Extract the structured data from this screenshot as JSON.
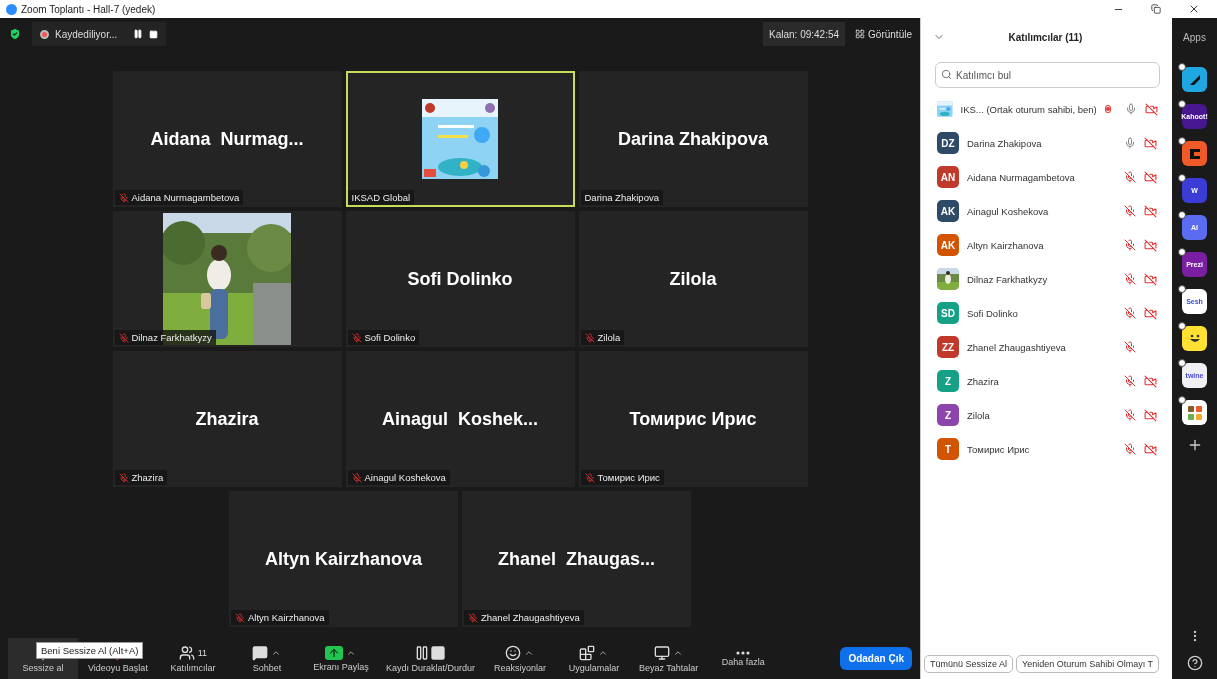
{
  "window": {
    "title": "Zoom Toplantı - Hall-7 (yedek)"
  },
  "top_bar": {
    "recording": "Kaydediliyor...",
    "remaining": "Kalan: 09:42:54",
    "view": "Görüntüle"
  },
  "tile_rows": [
    [
      {
        "kind": "name",
        "big_name": "Aidana  Nurmag...",
        "label": "Aidana Nurmagambetova",
        "muted": true,
        "selected": false
      },
      {
        "kind": "logo",
        "label": "IKSAD Global",
        "muted": false,
        "selected": true
      },
      {
        "kind": "name",
        "big_name": "Darina Zhakipova",
        "label": "Darina Zhakipova",
        "muted": false,
        "selected": false
      }
    ],
    [
      {
        "kind": "video",
        "label": "Dilnaz Farkhatkyzy",
        "muted": true,
        "selected": false
      },
      {
        "kind": "name",
        "big_name": "Sofi Dolinko",
        "label": "Sofi Dolinko",
        "muted": true,
        "selected": false
      },
      {
        "kind": "name",
        "big_name": "Zilola",
        "label": "Zilola",
        "muted": true,
        "selected": false
      }
    ],
    [
      {
        "kind": "name",
        "big_name": "Zhazira",
        "label": "Zhazira",
        "muted": true,
        "selected": false
      },
      {
        "kind": "name",
        "big_name": "Ainagul  Koshek...",
        "label": "Ainagul Koshekova",
        "muted": true,
        "selected": false
      },
      {
        "kind": "name",
        "big_name": "Томирис Ирис",
        "label": "Томирис Ирис",
        "muted": true,
        "selected": false
      }
    ],
    [
      {
        "kind": "name",
        "big_name": "Altyn Kairzhanova",
        "label": "Altyn Kairzhanova",
        "muted": true,
        "selected": false
      },
      {
        "kind": "name",
        "big_name": "Zhanel  Zhaugas...",
        "label": "Zhanel Zhaugashtiyeva",
        "muted": true,
        "selected": false
      }
    ]
  ],
  "toolbar": [
    {
      "kind": "mic",
      "label": "Sessize al",
      "has_menu": false,
      "selected": true
    },
    {
      "kind": "video",
      "label": "Videoyu Başlat",
      "has_menu": true,
      "selected": false
    },
    {
      "kind": "participants",
      "label": "Katılımcılar",
      "count": "11",
      "has_menu": false,
      "selected": false
    },
    {
      "kind": "chat",
      "label": "Sohbet",
      "has_menu": true,
      "selected": false
    },
    {
      "kind": "share",
      "label": "Ekranı Paylaş",
      "has_menu": true,
      "selected": false
    },
    {
      "kind": "record",
      "label": "Kaydı Duraklat/Durdur",
      "has_menu": false,
      "selected": false
    },
    {
      "kind": "reactions",
      "label": "Reaksiyonlar",
      "has_menu": true,
      "selected": false
    },
    {
      "kind": "apps",
      "label": "Uygulamalar",
      "has_menu": true,
      "selected": false
    },
    {
      "kind": "whiteboard",
      "label": "Beyaz Tahtalar",
      "has_menu": true,
      "selected": false
    },
    {
      "kind": "more",
      "label": "Daha fazla",
      "has_menu": false,
      "selected": false
    }
  ],
  "tooltip": "Beni Sessize Al (Alt+A)",
  "leave_button": "Odadan Çık",
  "participants_panel": {
    "title": "Katılımcılar (11)",
    "search": {
      "placeholder": "Katılımcı bul"
    },
    "participants": [
      {
        "kind": "logo",
        "name": "IKS... (Ortak oturum sahibi, ben)",
        "recording": true,
        "muted": false,
        "video_off": true
      },
      {
        "kind": "initials",
        "initials": "DZ",
        "color": "#2e4a66",
        "name": "Darina Zhakipova",
        "recording": false,
        "muted": false,
        "video_off": true
      },
      {
        "kind": "initials",
        "initials": "AN",
        "color": "#c0392b",
        "name": "Aidana Nurmagambetova",
        "recording": false,
        "muted": true,
        "video_off": true
      },
      {
        "kind": "initials",
        "initials": "AK",
        "color": "#2e4a66",
        "name": "Ainagul Koshekova",
        "recording": false,
        "muted": true,
        "video_off": true
      },
      {
        "kind": "initials",
        "initials": "AK",
        "color": "#d35400",
        "name": "Altyn Kairzhanova",
        "recording": false,
        "muted": true,
        "video_off": true
      },
      {
        "name": "Dilnaz Farkhatkyzy",
        "recording": false,
        "muted": true,
        "video_off": true
      },
      {
        "kind": "initials",
        "initials": "SD",
        "color": "#16a085",
        "name": "Sofi Dolinko",
        "recording": false,
        "muted": true,
        "video_off": true
      },
      {
        "kind": "initials",
        "initials": "ZZ",
        "color": "#c0392b",
        "name": "Zhanel Zhaugashtiyeva",
        "recording": false,
        "muted": true,
        "video_off": false
      },
      {
        "kind": "initials",
        "initials": "Z",
        "color": "#16a085",
        "name": "Zhazira",
        "recording": false,
        "muted": true,
        "video_off": true
      },
      {
        "kind": "initials",
        "initials": "Z",
        "color": "#8e44ad",
        "name": "Zilola",
        "recording": false,
        "muted": true,
        "video_off": true
      },
      {
        "kind": "initials",
        "initials": "T",
        "color": "#d35400",
        "name": "Томирис Ирис",
        "recording": false,
        "muted": true,
        "video_off": true
      }
    ],
    "buttons": [
      "Tümünü Sessize Al",
      "Yeniden Oturum Sahibi Olmayı T"
    ]
  },
  "apps_bar": {
    "title": "Apps",
    "apps": [
      {
        "kind": "arrow",
        "color": "#1ea7e1"
      },
      {
        "kind": "text",
        "label": "Kahoot!",
        "color": "#46178f"
      },
      {
        "kind": "block",
        "color": "#f05a28"
      },
      {
        "kind": "letter",
        "label": "W",
        "color": "#3b3bd6"
      },
      {
        "kind": "ai",
        "label": "AI",
        "color": "#5b6cf0"
      },
      {
        "kind": "text",
        "label": "Prezi",
        "color": "#7b1fa2"
      },
      {
        "kind": "sesh",
        "label": "Sesh",
        "color": "#ffffff"
      },
      {
        "kind": "smile",
        "color": "#ffe033"
      },
      {
        "kind": "twine",
        "label": "twine",
        "color": "#f1f1f5"
      },
      {
        "kind": "tiles",
        "color": "#ffffff"
      }
    ]
  }
}
